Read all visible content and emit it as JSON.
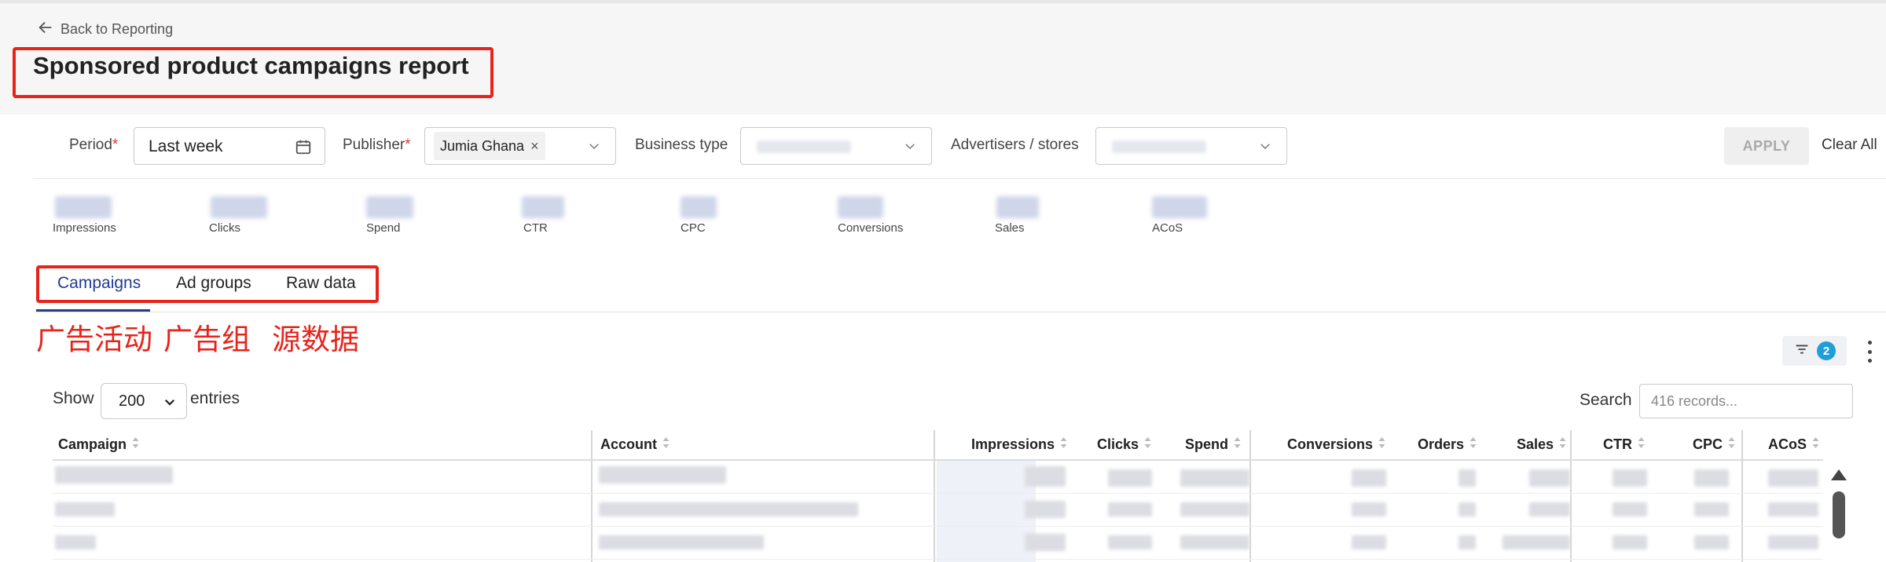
{
  "nav": {
    "back_label": "Back to Reporting"
  },
  "page": {
    "title": "Sponsored product campaigns report"
  },
  "filters": {
    "period": {
      "label": "Period",
      "required_mark": "*",
      "value": "Last week"
    },
    "publisher": {
      "label": "Publisher",
      "required_mark": "*",
      "tag": "Jumia Ghana",
      "tag_remove": "×"
    },
    "business_type": {
      "label": "Business type"
    },
    "advertisers": {
      "label": "Advertisers / stores"
    },
    "apply_label": "APPLY",
    "clear_label": "Clear All"
  },
  "metrics": [
    "Impressions",
    "Clicks",
    "Spend",
    "CTR",
    "CPC",
    "Conversions",
    "Sales",
    "ACoS"
  ],
  "tabs": [
    {
      "label": "Campaigns",
      "active": true
    },
    {
      "label": "Ad groups",
      "active": false
    },
    {
      "label": "Raw data",
      "active": false
    }
  ],
  "annotations": [
    "广告活动",
    "广告组",
    "源数据"
  ],
  "toolbar": {
    "filter_count": "2"
  },
  "table_controls": {
    "show_label": "Show",
    "entries_value": "200",
    "entries_label": "entries",
    "search_label": "Search",
    "search_placeholder": "416 records..."
  },
  "table": {
    "columns": [
      "Campaign",
      "Account",
      "Impressions",
      "Clicks",
      "Spend",
      "Conversions",
      "Orders",
      "Sales",
      "CTR",
      "CPC",
      "ACoS"
    ]
  },
  "colors": {
    "highlight": "#e8231b",
    "tab_active": "#1f3a93",
    "badge": "#1e9fd8"
  },
  "icons": {
    "back": "arrow-left-icon",
    "calendar": "calendar-icon",
    "chevron": "chevron-down-icon",
    "filter": "filter-icon",
    "more": "kebab-menu-icon",
    "sort": "sort-icon"
  }
}
